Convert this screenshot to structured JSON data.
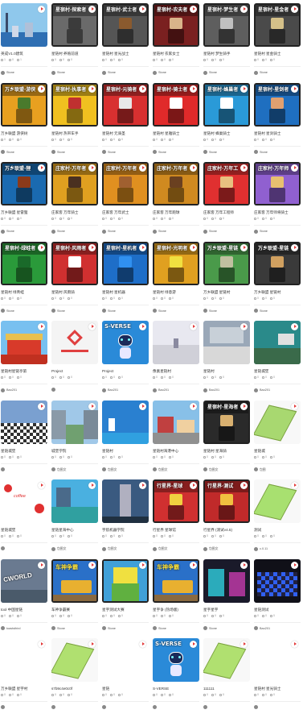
{
  "cards": [
    {
      "title": "英成V1.0建筑",
      "views": "1",
      "likes": "0",
      "comments": "1",
      "author": "Stone",
      "banner": "",
      "scene": "city",
      "bg": "#8fc8ec",
      "accent": "#2f6fb3",
      "bordered": false
    },
    {
      "title": "星链村 养殖前道",
      "views": "0",
      "likes": "0",
      "comments": "0",
      "author": "Stone",
      "banner": "星宿村·探索者",
      "scene": "char",
      "bg": "#6a6a6a",
      "accent": "#3b3b3b",
      "bordered": true
    },
    {
      "title": "星链村 星光战士",
      "views": "0",
      "likes": "0",
      "comments": "0",
      "author": "Stone",
      "banner": "星宿村·武士者",
      "scene": "char",
      "bg": "#555555",
      "accent": "#8a5a2e",
      "bordered": true
    },
    {
      "title": "星链村 农家女士",
      "views": "0",
      "likes": "0",
      "comments": "0",
      "author": "Stone",
      "banner": "星宿村·农夫者",
      "scene": "char",
      "bg": "#7a2020",
      "accent": "#d9b48a",
      "bordered": true
    },
    {
      "title": "星链村 梦生骑手",
      "views": "0",
      "likes": "0",
      "comments": "0",
      "author": "Stone",
      "banner": "星宿村·梦生者",
      "scene": "char",
      "bg": "#5e5e5e",
      "accent": "#c0c0c0",
      "bordered": true
    },
    {
      "title": "星链村 星金骑士",
      "views": "0",
      "likes": "0",
      "comments": "0",
      "author": "Stone",
      "banner": "星宿村·星金者",
      "scene": "char",
      "bg": "#4a4a4a",
      "accent": "#d4c089",
      "bordered": true
    },
    {
      "title": "万乡联盟 游侠树",
      "views": "0",
      "likes": "0",
      "comments": "0",
      "author": "Stone",
      "banner": "万乡联盟·游侠",
      "scene": "char",
      "bg": "#e8a020",
      "accent": "#4a7a2c",
      "bordered": true
    },
    {
      "title": "星链村 热带车手",
      "views": "0",
      "likes": "0",
      "comments": "0",
      "author": "Stone",
      "banner": "星宿村·执事者",
      "scene": "char",
      "bg": "#f0c020",
      "accent": "#c03030",
      "bordered": true
    },
    {
      "title": "星链村 元骑圣",
      "views": "0",
      "likes": "0",
      "comments": "0",
      "author": "Stone",
      "banner": "星宿村·元骑者",
      "scene": "char",
      "bg": "#d83030",
      "accent": "#e8e8e8",
      "bordered": true
    },
    {
      "title": "星链村 星雅骑士",
      "views": "0",
      "likes": "0",
      "comments": "0",
      "author": "Stone",
      "banner": "星宿村·骑士者",
      "scene": "char",
      "bg": "#e02a2a",
      "accent": "#ffffff",
      "bordered": true
    },
    {
      "title": "星链村 蜂巢骑士",
      "views": "0",
      "likes": "0",
      "comments": "0",
      "author": "Stone",
      "banner": "星宿村·蜂巢者",
      "scene": "char",
      "bg": "#2a9ad8",
      "accent": "#ffffff",
      "bordered": true
    },
    {
      "title": "星链村 星剑骑士",
      "views": "0",
      "likes": "0",
      "comments": "0",
      "author": "Stone",
      "banner": "星宿村·星剑者",
      "scene": "char",
      "bg": "#1f6fc0",
      "accent": "#e0a070",
      "bordered": true
    },
    {
      "title": "万乡联盟 星雷狸",
      "views": "0",
      "likes": "0",
      "comments": "0",
      "author": "Stone",
      "banner": "万乡联盟·狸",
      "scene": "char",
      "bg": "#1a6ab0",
      "accent": "#8b3a1a",
      "bordered": true
    },
    {
      "title": "庄家客 万年骑士",
      "views": "0",
      "likes": "0",
      "comments": "0",
      "author": "Stone",
      "banner": "庄家村·万年者",
      "scene": "char",
      "bg": "#e0a020",
      "accent": "#4a3020",
      "bordered": true
    },
    {
      "title": "庄家客 万年武士",
      "views": "0",
      "likes": "0",
      "comments": "0",
      "author": "Stone",
      "banner": "庄家村·万年者",
      "scene": "char",
      "bg": "#e09020",
      "accent": "#a06030",
      "bordered": true
    },
    {
      "title": "庄家客 万年跑球",
      "views": "0",
      "likes": "0",
      "comments": "0",
      "author": "Stone",
      "banner": "庄家村·万年者",
      "scene": "char",
      "bg": "#d08a20",
      "accent": "#6a4020",
      "bordered": true
    },
    {
      "title": "庄家客 万年工程师",
      "views": "0",
      "likes": "0",
      "comments": "0",
      "author": "Stone",
      "banner": "庄家村·万年工",
      "scene": "char",
      "bg": "#e03030",
      "accent": "#e8c080",
      "bordered": true
    },
    {
      "title": "庄家客 万年师将骑士",
      "views": "0",
      "likes": "0",
      "comments": "0",
      "author": "Stone",
      "banner": "庄家村·万年师",
      "scene": "char",
      "bg": "#9060d0",
      "accent": "#e8c070",
      "bordered": true
    },
    {
      "title": "星链村 绿青蛙",
      "views": "0",
      "likes": "0",
      "comments": "0",
      "author": "Stone",
      "banner": "星宿村·绿蛙者",
      "scene": "char",
      "bg": "#2a9a3a",
      "accent": "#1a6a2a",
      "bordered": true
    },
    {
      "title": "星链村 风雨骑",
      "views": "0",
      "likes": "0",
      "comments": "0",
      "author": "Stone",
      "banner": "星宿村·风雨者",
      "scene": "char",
      "bg": "#d03030",
      "accent": "#ffffff",
      "bordered": true
    },
    {
      "title": "星链村 星机器",
      "views": "0",
      "likes": "0",
      "comments": "0",
      "author": "Stone",
      "banner": "星宿村·星机者",
      "scene": "char",
      "bg": "#1e6ec8",
      "accent": "#3090f0",
      "bordered": true
    },
    {
      "title": "星链村 绿意游",
      "views": "0",
      "likes": "0",
      "comments": "0",
      "author": "Stone",
      "banner": "星宿村·光明者",
      "scene": "char",
      "bg": "#e0a020",
      "accent": "#f0e040",
      "bordered": true
    },
    {
      "title": "万乡联盟 星链村",
      "views": "0",
      "likes": "0",
      "comments": "0",
      "author": "Stone",
      "banner": "万乡联盟·星链",
      "scene": "char",
      "bg": "#4a9a4a",
      "accent": "#c0c0a0",
      "bordered": true
    },
    {
      "title": "万乡联盟 星链村",
      "views": "0",
      "likes": "0",
      "comments": "0",
      "author": "Stone",
      "banner": "万乡联盟·星链",
      "scene": "char",
      "bg": "#3a3a3a",
      "accent": "#d0a060",
      "bordered": true
    },
    {
      "title": "星链村星链亭第",
      "views": "0",
      "likes": "0",
      "comments": "0",
      "author": "Bao201",
      "banner": "",
      "scene": "palace",
      "bg": "#78c0f0",
      "accent": "#d83a2a",
      "bordered": false
    },
    {
      "title": "Project",
      "views": "0",
      "likes": "0",
      "comments": "0",
      "author": "",
      "banner": "",
      "scene": "logo",
      "bg": "#f4f4f4",
      "accent": "#e04040",
      "bordered": false
    },
    {
      "title": "Project",
      "views": "0",
      "likes": "0",
      "comments": "0",
      "author": "Bao201",
      "banner": "S-VERSE",
      "scene": "robot",
      "bg": "#2a8ad8",
      "accent": "#ffffff",
      "bordered": false
    },
    {
      "title": "像素星链村",
      "views": "0",
      "likes": "0",
      "comments": "0",
      "author": "Bao201",
      "banner": "",
      "scene": "field",
      "bg": "#e8e8f0",
      "accent": "#8a8aa0",
      "bordered": false
    },
    {
      "title": "星链村",
      "views": "0",
      "likes": "0",
      "comments": "0",
      "author": "Bao201",
      "banner": "",
      "scene": "room",
      "bg": "#9aa8b8",
      "accent": "#d8d8d8",
      "bordered": false
    },
    {
      "title": "星链城堡",
      "views": "0",
      "likes": "0",
      "comments": "0",
      "author": "Bao201",
      "banner": "",
      "scene": "interior",
      "bg": "#2a8a8a",
      "accent": "#e0e0e0",
      "bordered": false
    },
    {
      "title": "星链城堡",
      "views": "0",
      "likes": "0",
      "comments": "0",
      "author": "",
      "banner": "",
      "scene": "checker",
      "bg": "#7aa0d0",
      "accent": "#303030",
      "bordered": false
    },
    {
      "title": "城堡学院",
      "views": "0",
      "likes": "0",
      "comments": "0",
      "author": "包图文",
      "banner": "",
      "scene": "street",
      "bg": "#a0c8e8",
      "accent": "#70a070",
      "bordered": false
    },
    {
      "title": "星链村",
      "views": "0",
      "likes": "0",
      "comments": "0",
      "author": "包图文",
      "banner": "",
      "scene": "water",
      "bg": "#2a80d0",
      "accent": "#ffffff",
      "bordered": false
    },
    {
      "title": "星链村海港中心",
      "views": "0",
      "likes": "0",
      "comments": "0",
      "author": "包图文",
      "banner": "",
      "scene": "town",
      "bg": "#88c0e8",
      "accent": "#c04040",
      "bordered": false
    },
    {
      "title": "星链村 星海骑",
      "views": "0",
      "likes": "0",
      "comments": "0",
      "author": "包图文",
      "banner": "星宿村·星海者",
      "scene": "char",
      "bg": "#2a2a2a",
      "accent": "#d8b070",
      "bordered": true
    },
    {
      "title": "星链城",
      "views": "0",
      "likes": "0",
      "comments": "0",
      "author": "包图",
      "banner": "",
      "scene": "plane",
      "bg": "#f8f8f8",
      "accent": "#a8d870",
      "bordered": false
    },
    {
      "title": "星链城堡",
      "views": "0",
      "likes": "0",
      "comments": "0",
      "author": "",
      "banner": "coffee",
      "scene": "poster",
      "bg": "#ffffff",
      "accent": "#e03030",
      "bordered": false
    },
    {
      "title": "星链星海中心",
      "views": "0",
      "likes": "0",
      "comments": "0",
      "author": "包图文",
      "banner": "",
      "scene": "pool",
      "bg": "#4ab0e0",
      "accent": "#30a0a0",
      "bordered": false
    },
    {
      "title": "宇航机器学院",
      "views": "0",
      "likes": "0",
      "comments": "0",
      "author": "包图文",
      "banner": "",
      "scene": "tower",
      "bg": "#3a5a80",
      "accent": "#b0b0c0",
      "bordered": false
    },
    {
      "title": "行星界 星球馆",
      "views": "0",
      "likes": "0",
      "comments": "0",
      "author": "包图文",
      "banner": "行星界·星球",
      "scene": "char",
      "bg": "#d03030",
      "accent": "#f0d040",
      "bordered": true
    },
    {
      "title": "行星界 (测试v4.5)",
      "views": "0",
      "likes": "0",
      "comments": "0",
      "author": "包图文",
      "banner": "行星界·测试",
      "scene": "char",
      "bg": "#c02a2a",
      "accent": "#f0c040",
      "bordered": true
    },
    {
      "title": "测试",
      "views": "0",
      "likes": "0",
      "comments": "0",
      "author": "c.0.11",
      "banner": "",
      "scene": "plane",
      "bg": "#f8f8f8",
      "accent": "#a8e070",
      "bordered": false
    },
    {
      "title": "tool 中国星链",
      "views": "0",
      "likes": "0",
      "comments": "0",
      "author": "toaststhird",
      "banner": "CWORLD",
      "scene": "cworld",
      "bg": "#6a7a90",
      "accent": "#ffffff",
      "bordered": false
    },
    {
      "title": "车神争霸赛",
      "views": "0",
      "likes": "0",
      "comments": "0",
      "author": "Stone",
      "banner": "车神争霸",
      "scene": "car",
      "bg": "#2a70c8",
      "accent": "#e8b030",
      "bordered": true
    },
    {
      "title": "星宇测试大赛",
      "views": "0",
      "likes": "0",
      "comments": "0",
      "author": "Stone",
      "banner": "",
      "scene": "bigchar",
      "bg": "#40a0d8",
      "accent": "#f0e040",
      "bordered": true
    },
    {
      "title": "星宇争 (热场版)",
      "views": "0",
      "likes": "0",
      "comments": "0",
      "author": "Stone",
      "banner": "车神争霸",
      "scene": "car",
      "bg": "#2a70c8",
      "accent": "#e8b030",
      "bordered": true
    },
    {
      "title": "星宇星宇",
      "views": "0",
      "likes": "0",
      "comments": "0",
      "author": "Stone",
      "banner": "",
      "scene": "neon",
      "bg": "#1a1a2a",
      "accent": "#30d0e0",
      "bordered": false
    },
    {
      "title": "星链测试",
      "views": "0",
      "likes": "0",
      "comments": "0",
      "author": "Bao201",
      "banner": "",
      "scene": "dance",
      "bg": "#101018",
      "accent": "#3060f0",
      "bordered": false
    },
    {
      "title": "万乡联盟 星宇村",
      "views": "0",
      "likes": "0",
      "comments": "0",
      "author": "",
      "banner": "",
      "scene": "blank",
      "bg": "#ffffff",
      "accent": "#ffffff",
      "bordered": false
    },
    {
      "title": "s7b9c4e0c0f",
      "views": "0",
      "likes": "0",
      "comments": "0",
      "author": "",
      "banner": "",
      "scene": "plane",
      "bg": "#f8f8f8",
      "accent": "#b0e070",
      "bordered": false
    },
    {
      "title": "星链",
      "views": "0",
      "likes": "0",
      "comments": "0",
      "author": "",
      "banner": "",
      "scene": "blank",
      "bg": "#ffffff",
      "accent": "#ffffff",
      "bordered": false
    },
    {
      "title": "S-VERSE",
      "views": "0",
      "likes": "0",
      "comments": "0",
      "author": "",
      "banner": "S-VERSE",
      "scene": "robot",
      "bg": "#2a8ad8",
      "accent": "#ffffff",
      "bordered": false
    },
    {
      "title": "111111",
      "views": "0",
      "likes": "0",
      "comments": "0",
      "author": "",
      "banner": "",
      "scene": "plane",
      "bg": "#f8f8f8",
      "accent": "#b0e070",
      "bordered": false
    },
    {
      "title": "星链村 星光骑士",
      "views": "0",
      "likes": "0",
      "comments": "0",
      "author": "",
      "banner": "",
      "scene": "blank",
      "bg": "#ffffff",
      "accent": "#ffffff",
      "bordered": false
    }
  ]
}
